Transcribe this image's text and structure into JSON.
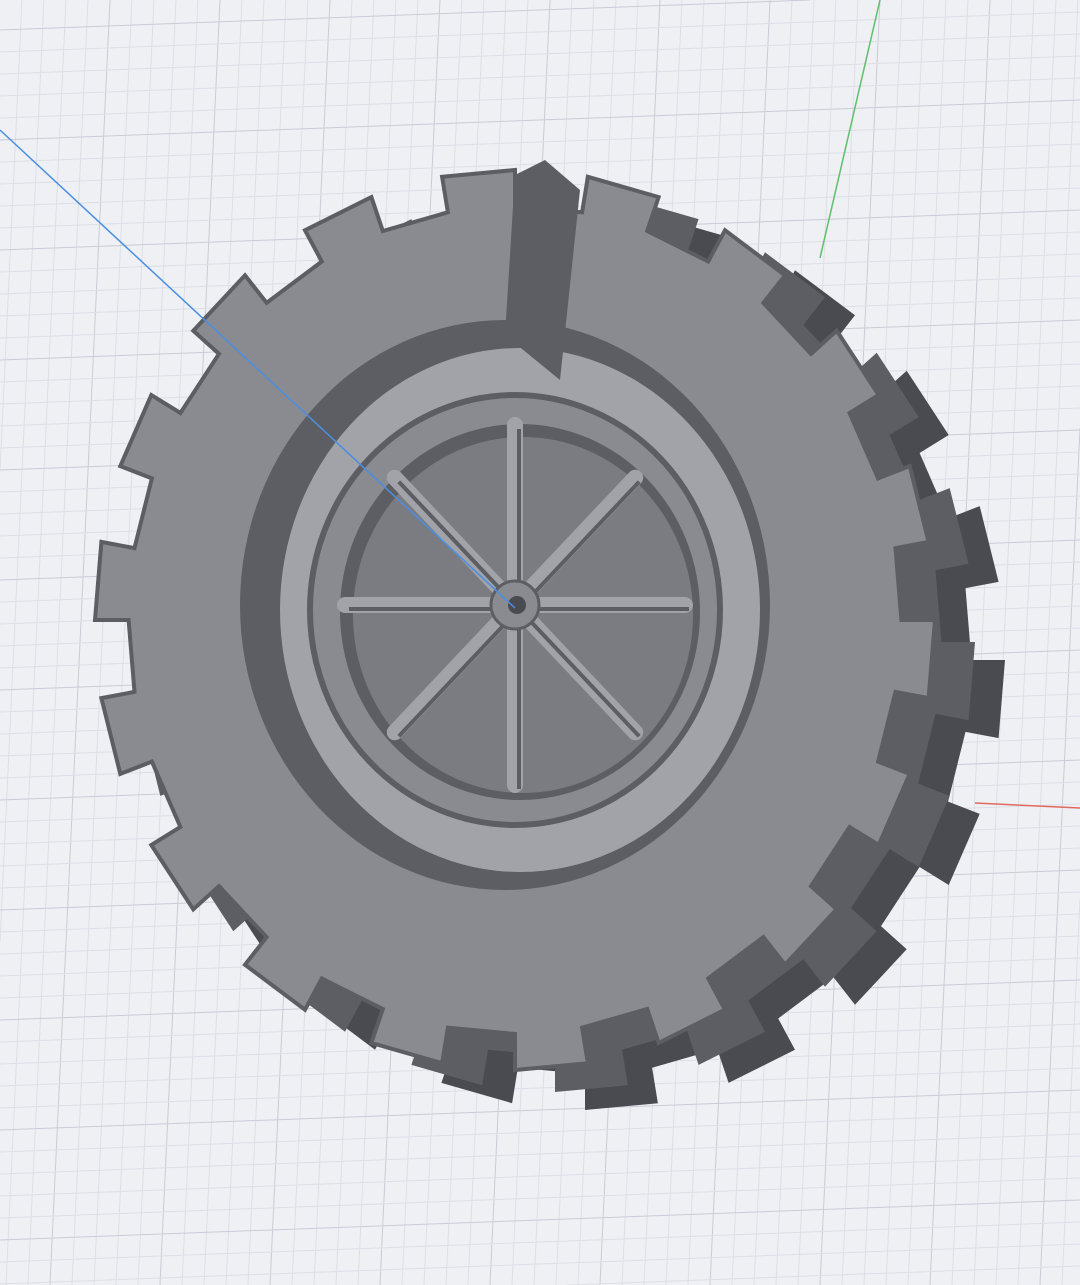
{
  "viewport": {
    "type": "3d-cad-viewport",
    "grid": true,
    "axes": {
      "x_color": "#e06a5f",
      "y_color": "#5fbf6a",
      "z_color": "#4a8fe0"
    },
    "model": {
      "name_icon": "tire-model",
      "lug_count": 18,
      "spoke_count": 8
    }
  },
  "colors": {
    "background": "#eef0f4",
    "grid_minor": "#dcdfe6",
    "grid_major": "#c9ccd5",
    "tire_face": "#8a8b91",
    "tire_side": "#5d5e63",
    "tire_dark": "#4a4b50",
    "tire_light": "#a2a3a8"
  }
}
